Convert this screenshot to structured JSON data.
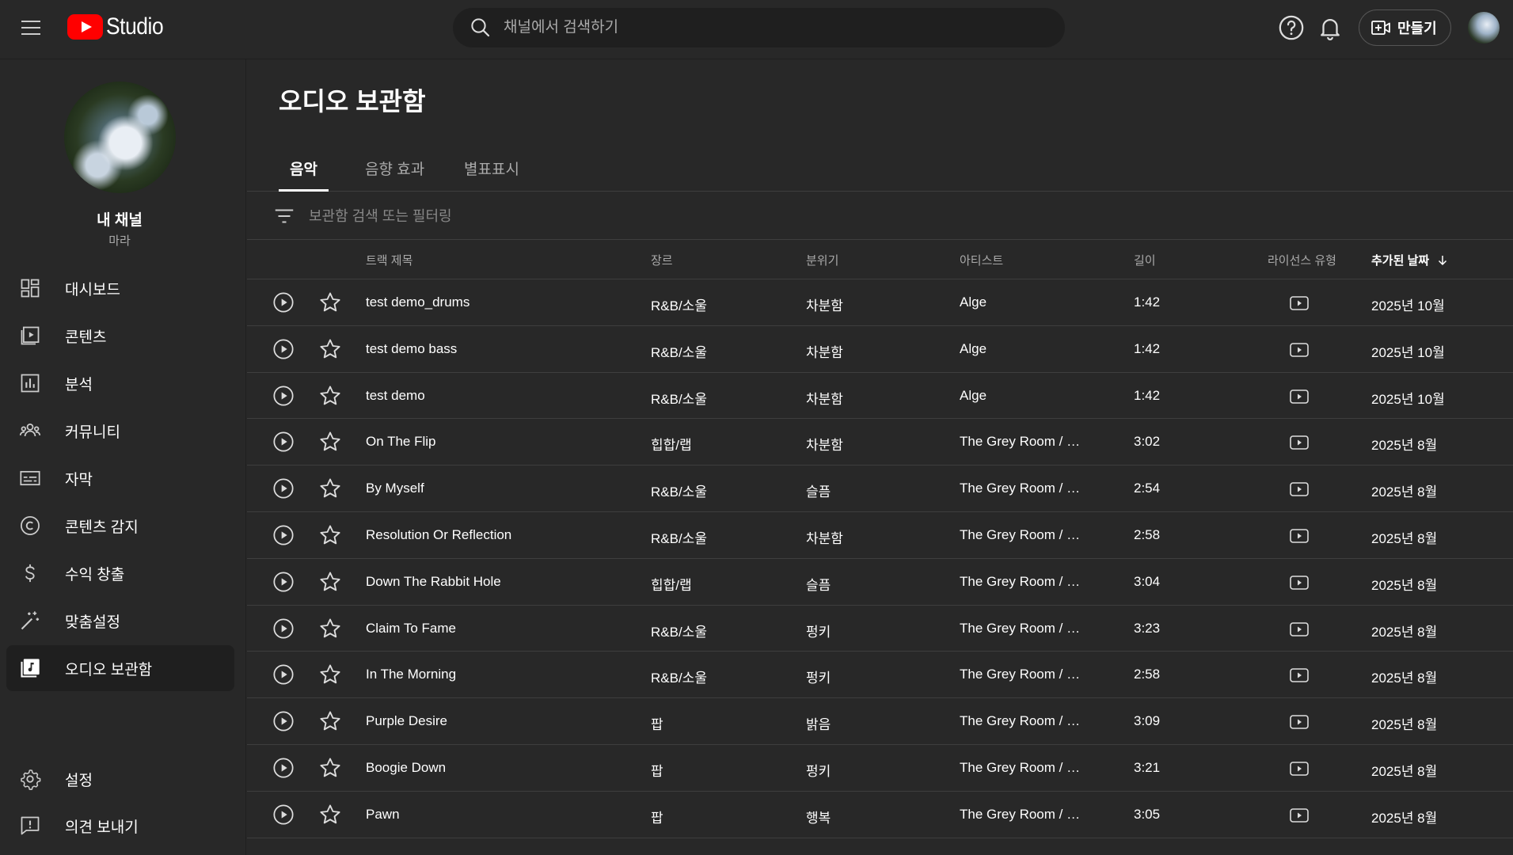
{
  "header": {
    "logo_text": "Studio",
    "search_placeholder": "채널에서 검색하기",
    "create_label": "만들기",
    "icons": [
      "menu-icon",
      "search-icon",
      "help-icon",
      "bell-icon",
      "create-video-icon"
    ]
  },
  "sidebar": {
    "channel_name": "내 채널",
    "channel_handle": "마라",
    "items": [
      {
        "label": "대시보드",
        "icon": "dashboard-icon"
      },
      {
        "label": "콘텐츠",
        "icon": "content-icon"
      },
      {
        "label": "분석",
        "icon": "analytics-icon"
      },
      {
        "label": "커뮤니티",
        "icon": "community-icon"
      },
      {
        "label": "자막",
        "icon": "subtitles-icon"
      },
      {
        "label": "콘텐츠 감지",
        "icon": "copyright-icon"
      },
      {
        "label": "수익 창출",
        "icon": "dollar-icon"
      },
      {
        "label": "맞춤설정",
        "icon": "magic-wand-icon"
      },
      {
        "label": "오디오 보관함",
        "icon": "audio-library-icon",
        "active": true
      }
    ],
    "bottom_items": [
      {
        "label": "설정",
        "icon": "gear-icon"
      },
      {
        "label": "의견 보내기",
        "icon": "feedback-icon"
      }
    ]
  },
  "main": {
    "title": "오디오 보관함",
    "tabs": [
      {
        "label": "음악",
        "active": true
      },
      {
        "label": "음향 효과"
      },
      {
        "label": "별표표시"
      }
    ],
    "filter_placeholder": "보관함 검색 또는 필터링",
    "columns": {
      "title": "트랙 제목",
      "genre": "장르",
      "mood": "분위기",
      "artist": "아티스트",
      "length": "길이",
      "license": "라이선스 유형",
      "added": "추가된 날짜"
    },
    "rows": [
      {
        "title": "test demo_drums",
        "genre": "R&B/소울",
        "mood": "차분함",
        "artist": "Alge",
        "length": "1:42",
        "added": "2025년 10월"
      },
      {
        "title": "test demo bass",
        "genre": "R&B/소울",
        "mood": "차분함",
        "artist": "Alge",
        "length": "1:42",
        "added": "2025년 10월"
      },
      {
        "title": "test demo",
        "genre": "R&B/소울",
        "mood": "차분함",
        "artist": "Alge",
        "length": "1:42",
        "added": "2025년 10월"
      },
      {
        "title": "On The Flip",
        "genre": "힙합/랩",
        "mood": "차분함",
        "artist": "The Grey Room / D...",
        "length": "3:02",
        "added": "2025년 8월"
      },
      {
        "title": "By Myself",
        "genre": "R&B/소울",
        "mood": "슬픔",
        "artist": "The Grey Room / Cl...",
        "length": "2:54",
        "added": "2025년 8월"
      },
      {
        "title": "Resolution Or Reflection",
        "genre": "R&B/소울",
        "mood": "차분함",
        "artist": "The Grey Room / Cl...",
        "length": "2:58",
        "added": "2025년 8월"
      },
      {
        "title": "Down The Rabbit Hole",
        "genre": "힙합/랩",
        "mood": "슬픔",
        "artist": "The Grey Room / D...",
        "length": "3:04",
        "added": "2025년 8월"
      },
      {
        "title": "Claim To Fame",
        "genre": "R&B/소울",
        "mood": "펑키",
        "artist": "The Grey Room / Cl...",
        "length": "3:23",
        "added": "2025년 8월"
      },
      {
        "title": "In The Morning",
        "genre": "R&B/소울",
        "mood": "펑키",
        "artist": "The Grey Room / Cl...",
        "length": "2:58",
        "added": "2025년 8월"
      },
      {
        "title": "Purple Desire",
        "genre": "팝",
        "mood": "밝음",
        "artist": "The Grey Room / Cl...",
        "length": "3:09",
        "added": "2025년 8월"
      },
      {
        "title": "Boogie Down",
        "genre": "팝",
        "mood": "펑키",
        "artist": "The Grey Room / G...",
        "length": "3:21",
        "added": "2025년 8월"
      },
      {
        "title": "Pawn",
        "genre": "팝",
        "mood": "행복",
        "artist": "The Grey Room / G...",
        "length": "3:05",
        "added": "2025년 8월"
      }
    ]
  },
  "colors": {
    "background": "#282828",
    "deep": "#1f1f1f",
    "divider": "#3e3e3e",
    "brand": "#ff0000",
    "muted_text": "#aaaaaa"
  }
}
